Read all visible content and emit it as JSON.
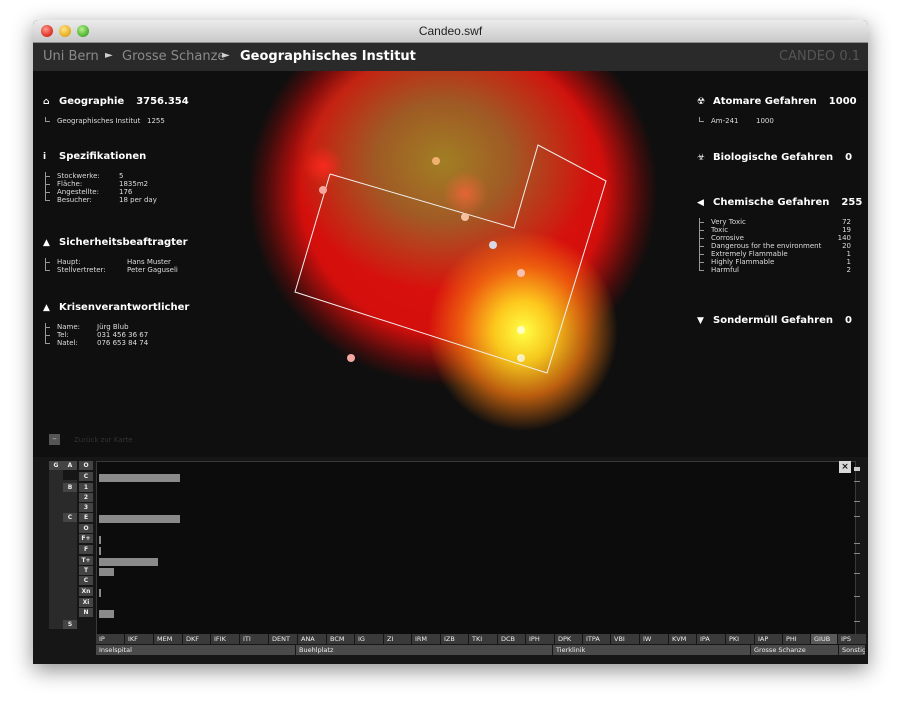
{
  "window": {
    "title": "Candeo.swf"
  },
  "breadcrumb": {
    "items": [
      "Uni Bern",
      "Grosse Schanze",
      "Geographisches Institut"
    ],
    "separator": "►"
  },
  "brand": "CANDEO 0.1",
  "left": {
    "geographie": {
      "title": "Geographie",
      "value": "3756.354",
      "rows": [
        {
          "k": "Geographisches Institut",
          "v": "1255"
        }
      ]
    },
    "spezifikationen": {
      "title": "Spezifikationen",
      "rows": [
        {
          "k": "Stockwerke:",
          "v": "5"
        },
        {
          "k": "Fläche:",
          "v": "1835m2"
        },
        {
          "k": "Angestellte:",
          "v": "176"
        },
        {
          "k": "Besucher:",
          "v": "18 per day"
        }
      ]
    },
    "sicherheit": {
      "title": "Sicherheitsbeaftragter",
      "rows": [
        {
          "k": "Haupt:",
          "v": "Hans Muster"
        },
        {
          "k": "Stellvertreter:",
          "v": "Peter Gaguseli"
        }
      ]
    },
    "krisen": {
      "title": "Krisenverantwortlicher",
      "rows": [
        {
          "k": "Name:",
          "v": "Jürg Blub"
        },
        {
          "k": "Tel:",
          "v": "031 456 36 67"
        },
        {
          "k": "Natel:",
          "v": "076 653 84 74"
        }
      ]
    },
    "back_label": "Zurück zur Karte",
    "back_button": "–"
  },
  "right": {
    "atomare": {
      "title": "Atomare Gefahren",
      "value": "1000",
      "rows": [
        {
          "k": "Am-241",
          "v": "1000"
        }
      ]
    },
    "biologische": {
      "title": "Biologische Gefahren",
      "value": "0"
    },
    "chemische": {
      "title": "Chemische Gefahren",
      "value": "255",
      "rows": [
        {
          "k": "Very Toxic",
          "v": "72"
        },
        {
          "k": "Toxic",
          "v": "19"
        },
        {
          "k": "Corrosive",
          "v": "140"
        },
        {
          "k": "Dangerous for the environment",
          "v": "20"
        },
        {
          "k": "Extremely Flammable",
          "v": "1"
        },
        {
          "k": "Highly Flammable",
          "v": "1"
        },
        {
          "k": "Harmful",
          "v": "2"
        }
      ]
    },
    "sondermuell": {
      "title": "Sondermüll Gefahren",
      "value": "0"
    }
  },
  "icons": {
    "geographie": "home-icon",
    "spezifikationen": "info-icon",
    "sicherheit": "person-icon",
    "krisen": "person-icon",
    "atomare": "radiation-icon",
    "biologische": "biohazard-icon",
    "chemische": "chemical-icon",
    "sondermuell": "waste-icon"
  },
  "matrix": {
    "labels": {
      "g": "G",
      "a": "A",
      "b": "B",
      "c": "C",
      "s": "S",
      "sub": [
        "O",
        "C",
        "1",
        "2",
        "3",
        "E",
        "O",
        "F+",
        "F",
        "T+",
        "T",
        "C",
        "Xn",
        "Xi",
        "N"
      ]
    },
    "bars": [
      0,
      0.37,
      0,
      0,
      0,
      0.37,
      0,
      0.01,
      0.01,
      0.27,
      0.07,
      0,
      0.01,
      0,
      0.07
    ],
    "close_label": "×"
  },
  "institutes": [
    "IP",
    "IKF",
    "MEM",
    "DKF",
    "IFIK",
    "ITI",
    "DENT",
    "ANA",
    "BCM",
    "IG",
    "ZI",
    "IRM",
    "IZB",
    "TKI",
    "DCB",
    "IPH",
    "DPK",
    "ITPA",
    "VBI",
    "IW",
    "KVM",
    "IPA",
    "PKI",
    "IAP",
    "PHI",
    "GIUB",
    "IPS"
  ],
  "locations": [
    "Inselspital",
    "Buehlplatz",
    "Tierklinik",
    "Grosse Schanze",
    "Sonstig"
  ],
  "colors": {
    "heat_red": "#e01010",
    "heat_yellow": "#ffff40",
    "panel_bg": "#0f0f0f"
  }
}
